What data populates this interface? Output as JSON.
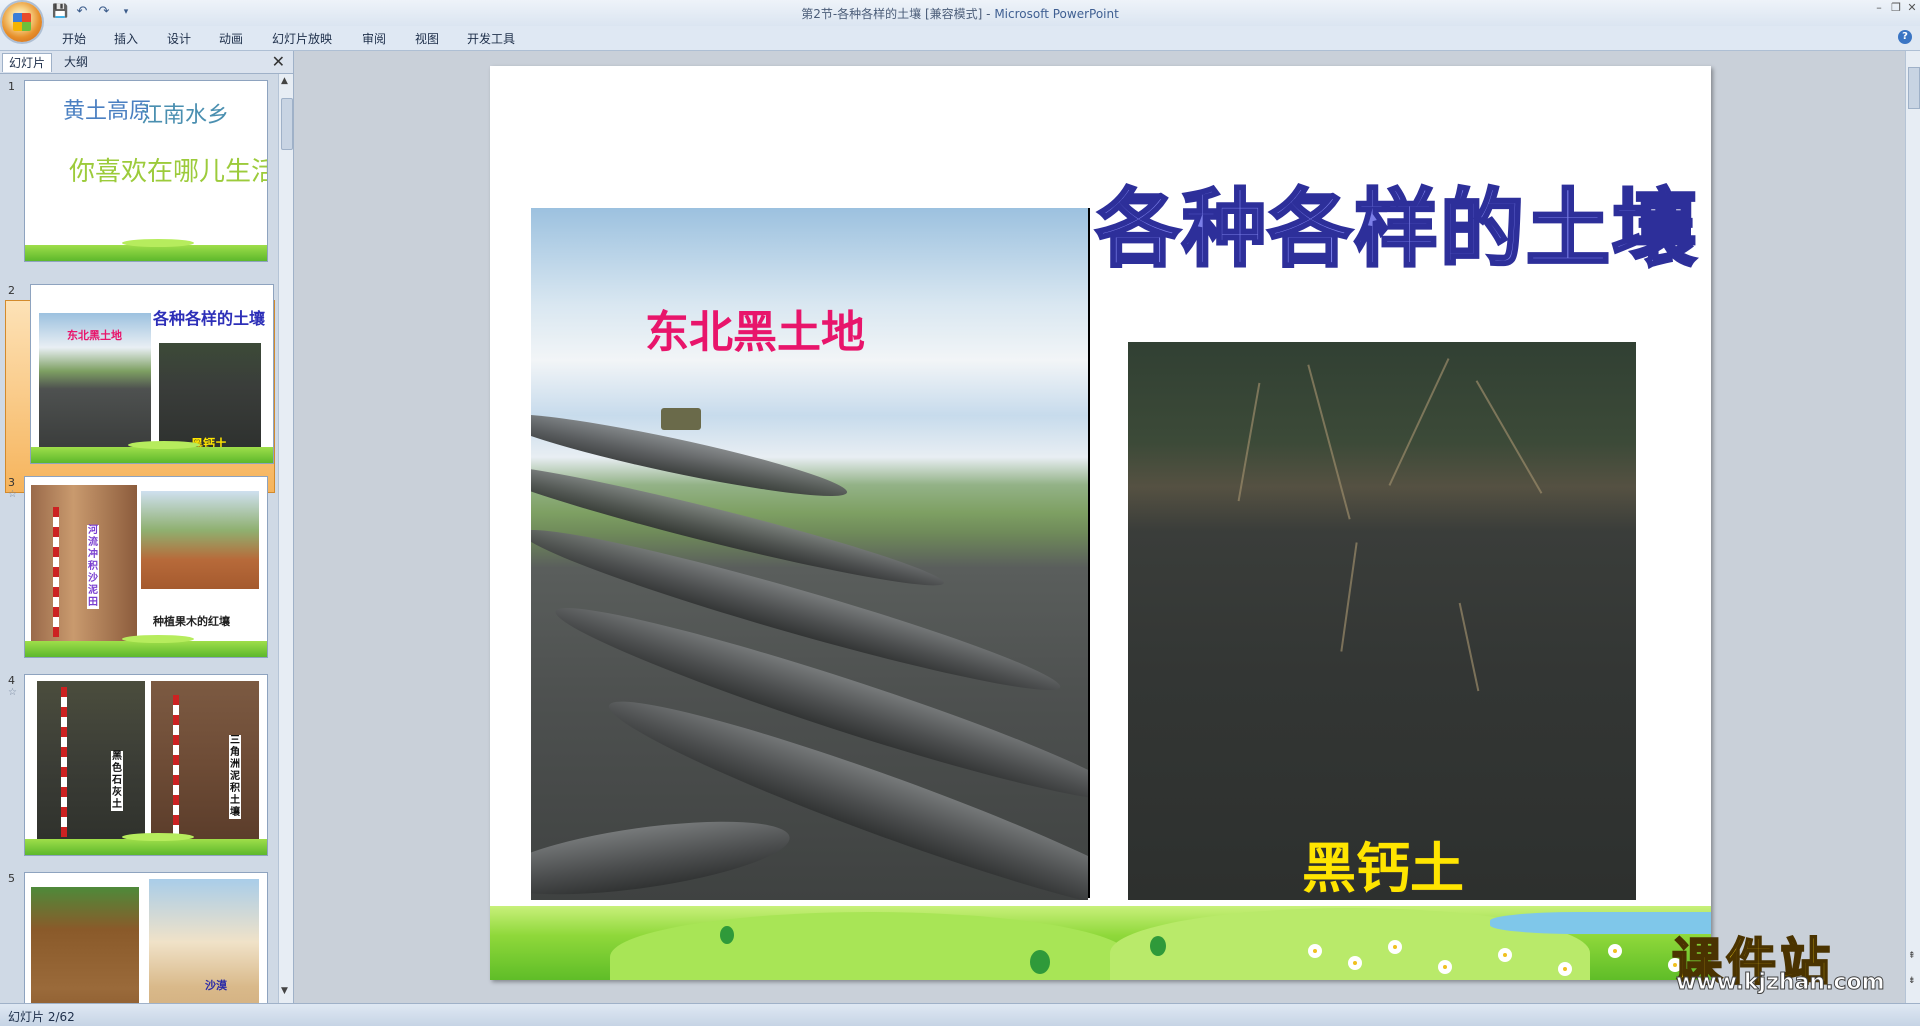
{
  "window": {
    "title": "第2节-各种各样的土壤 [兼容模式]",
    "app_name": "Microsoft PowerPoint",
    "title_separator": " - "
  },
  "ribbon": {
    "tabs": [
      "开始",
      "插入",
      "设计",
      "动画",
      "幻灯片放映",
      "审阅",
      "视图",
      "开发工具"
    ]
  },
  "left_pane": {
    "tab_slides": "幻灯片",
    "tab_outline": "大纲",
    "close_glyph": "✕",
    "slides": [
      {
        "number": "1",
        "lines": [
          "黄土高原",
          "江南水乡",
          "你喜欢在哪儿生活?"
        ]
      },
      {
        "number": "2",
        "title": "各种各样的土壤",
        "label_left": "东北黑土地",
        "label_right": "黑钙土"
      },
      {
        "number": "3",
        "label_vertical": "河流冲积沙泥田",
        "label_caption": "种植果木的红壤"
      },
      {
        "number": "4",
        "label_left": "黑色石灰土",
        "label_right": "三角洲泥积土壤"
      },
      {
        "number": "5",
        "label_right": "沙漠"
      }
    ]
  },
  "slide": {
    "title": "各种各样的土壤",
    "label_left": "东北黑土地",
    "label_right": "黑钙土"
  },
  "watermark": {
    "text_cn": "课件站",
    "url": "www.kjzhan.com"
  },
  "status": {
    "slide_indicator": "幻灯片 2/62"
  },
  "colors": {
    "title_fill": "#7b7fe8",
    "title_stroke": "#2d2f9a",
    "label_left": "#e8156b",
    "label_right": "#ffe500",
    "selection": "#f6b45c"
  }
}
